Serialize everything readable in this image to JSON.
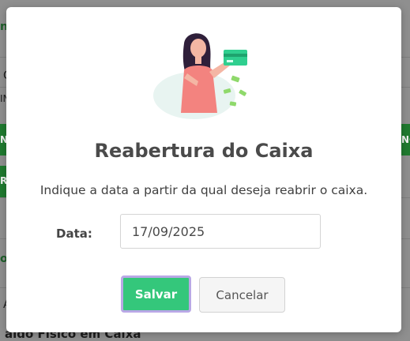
{
  "background": {
    "fragments": [
      "n",
      "O",
      "IN",
      "N",
      "R",
      "NC",
      "o",
      "A"
    ],
    "bottom_label": "aldo Físico em Caixa"
  },
  "modal": {
    "title": "Reabertura do Caixa",
    "description": "Indique a data a partir da qual deseja reabrir o caixa.",
    "date_label": "Data:",
    "date_value": "17/09/2025",
    "save_label": "Salvar",
    "cancel_label": "Cancelar",
    "illustration_icon": "woman-holding-credit-card-illustration"
  },
  "colors": {
    "accent_green": "#34c77b",
    "focus_outline": "#b9a8e6",
    "title_text": "#4a4a4a"
  }
}
